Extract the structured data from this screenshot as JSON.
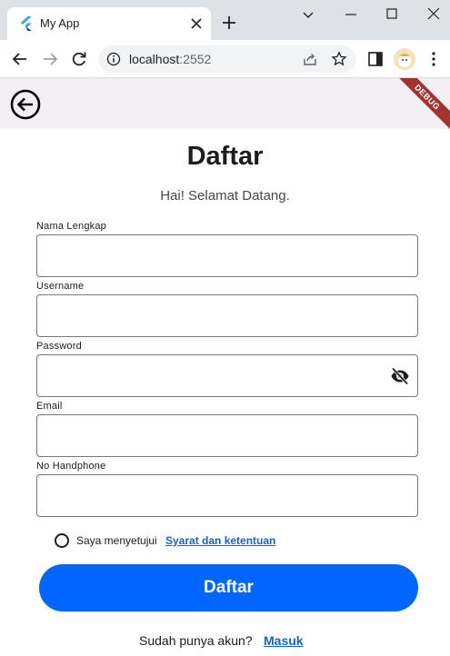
{
  "browser": {
    "tab_title": "My App",
    "url_host": "localhost",
    "url_port": ":2552"
  },
  "app": {
    "debug_banner": "DEBUG",
    "page_title": "Daftar",
    "subtitle": "Hai! Selamat Datang.",
    "fields": [
      {
        "label": "Nama Lengkap",
        "value": ""
      },
      {
        "label": "Username",
        "value": ""
      },
      {
        "label": "Password",
        "value": ""
      },
      {
        "label": "Email",
        "value": ""
      },
      {
        "label": "No Handphone",
        "value": ""
      }
    ],
    "agree_text": "Saya menyetujui",
    "terms_link": "Syarat dan ketentuan",
    "submit_label": "Daftar",
    "login_prompt": "Sudah punya akun?",
    "login_link": "Masuk"
  },
  "colors": {
    "primary": "#0066ff",
    "link": "#1565c0",
    "appbar": "#f3eff5",
    "debug": "#a2342f"
  }
}
